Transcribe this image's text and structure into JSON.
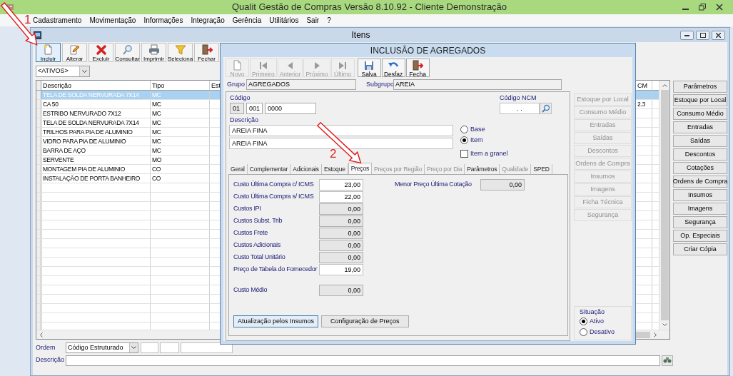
{
  "app": {
    "title": "Qualit Gestão de Compras Versão 8.10.92 - Cliente Demonstração"
  },
  "menu": [
    "Cadastramento",
    "Movimentação",
    "Informações",
    "Integração",
    "Gerência",
    "Utilitários",
    "Sair",
    "?"
  ],
  "itens_window": {
    "title": "Itens",
    "toolbar": [
      {
        "label": "Incluir",
        "kind": "new",
        "selected": true
      },
      {
        "label": "Alterar",
        "kind": "edit",
        "selected": false
      },
      {
        "label": "Excluir",
        "kind": "delete",
        "selected": false
      },
      {
        "label": "Consultar",
        "kind": "search",
        "selected": false
      },
      {
        "label": "Imprimir",
        "kind": "print",
        "selected": false
      },
      {
        "label": "Seleciona",
        "kind": "filter",
        "selected": false
      },
      {
        "label": "Fechar",
        "kind": "exit",
        "selected": false
      }
    ],
    "filter": "<ATIVOS>",
    "columns": [
      "Descrição",
      "Tipo",
      "Est"
    ],
    "ncm_header": "CM",
    "rows": [
      {
        "cells": [
          "TELA DE SOLDA NERVURADA 7X14",
          "MC"
        ],
        "selected": true
      },
      {
        "cells": [
          "CA 50",
          "MC"
        ],
        "ncm": "2.3",
        "selected": false
      },
      {
        "cells": [
          "ESTRIBO NERVURADO 7X12",
          "MC"
        ],
        "selected": false
      },
      {
        "cells": [
          "TELA DE SOLDA NERVURADA 7X14",
          "MC"
        ],
        "selected": false
      },
      {
        "cells": [
          "TRILHOS PARA PIA DE ALUMINIO",
          "MC"
        ],
        "selected": false
      },
      {
        "cells": [
          "VIDRO PARA PIA DE ALUMINIO",
          "MC"
        ],
        "selected": false
      },
      {
        "cells": [
          "BARRA DE AÇO",
          "MC"
        ],
        "selected": false
      },
      {
        "cells": [
          "SERVENTE",
          "MO"
        ],
        "selected": false
      },
      {
        "cells": [
          "MONTAGEM PIA DE ALUMINIO",
          "CO"
        ],
        "selected": false
      },
      {
        "cells": [
          "INSTALAÇÃO DE PORTA BANHEIRO",
          "CO"
        ],
        "selected": false
      }
    ],
    "side_buttons": [
      "Parâmetros",
      "Estoque por Local",
      "Consumo Médio",
      "Entradas",
      "Saídas",
      "Descontos",
      "Cotações",
      "Ordens de Compra",
      "Insumos",
      "Imagens",
      "Segurança",
      "Op. Especiais",
      "Criar Cópia"
    ],
    "order": {
      "label": "Ordem",
      "value": "Código Estruturado"
    },
    "search": {
      "label": "Descrição"
    }
  },
  "dialog": {
    "title": "INCLUSÃO DE AGREGADOS",
    "toolbar": [
      {
        "label": "Novo",
        "kind": "new",
        "disabled": true
      },
      {
        "label": "Primeiro",
        "kind": "first",
        "disabled": true
      },
      {
        "label": "Anterior",
        "kind": "prev",
        "disabled": true
      },
      {
        "label": "Próximo",
        "kind": "next",
        "disabled": true
      },
      {
        "label": "Último",
        "kind": "last",
        "disabled": true
      },
      {
        "label": "Salva",
        "kind": "save",
        "disabled": false
      },
      {
        "label": "Desfaz",
        "kind": "undo",
        "disabled": false
      },
      {
        "label": "Fecha",
        "kind": "exit",
        "disabled": false
      }
    ],
    "grupo": {
      "label": "Grupo",
      "value": "AGREGADOS"
    },
    "subgrupo": {
      "label": "Subgrupo",
      "value": "AREIA"
    },
    "codigo": {
      "label": "Código",
      "parts": [
        {
          "value": "01",
          "editable": false
        },
        {
          "value": "001",
          "editable": true
        },
        {
          "value": "0000",
          "editable": true
        }
      ]
    },
    "ncm": {
      "label": "Código NCM",
      "value": ". ."
    },
    "descricao": {
      "label": "Descrição",
      "lines": [
        "AREIA FINA",
        "AREIA FINA"
      ]
    },
    "type_options": [
      {
        "label": "Base",
        "selected": false
      },
      {
        "label": "Item",
        "selected": true
      }
    ],
    "granel": {
      "label": "Item a granel",
      "checked": false
    },
    "tabs": [
      {
        "label": "Geral",
        "selected": false,
        "disabled": false
      },
      {
        "label": "Complementar",
        "selected": false,
        "disabled": false
      },
      {
        "label": "Adicionais",
        "selected": false,
        "disabled": false
      },
      {
        "label": "Estoque",
        "selected": false,
        "disabled": false
      },
      {
        "label": "Preços",
        "selected": true,
        "disabled": false
      },
      {
        "label": "Preços por Região",
        "selected": false,
        "disabled": true
      },
      {
        "label": "Preço por Dia",
        "selected": false,
        "disabled": true
      },
      {
        "label": "Parâmetros",
        "selected": false,
        "disabled": false
      },
      {
        "label": "Qualidade",
        "selected": false,
        "disabled": true
      },
      {
        "label": "SPED",
        "selected": false,
        "disabled": false
      }
    ],
    "fields": [
      {
        "label": "Custo Última Compra c/ ICMS",
        "value": "23,00",
        "editable": true
      },
      {
        "label": "Custo Última Compra s/ ICMS",
        "value": "22,00",
        "editable": true
      },
      {
        "label": "Custos IPI",
        "value": "0,00",
        "editable": false
      },
      {
        "label": "Custos Subst. Trib",
        "value": "0,00",
        "editable": false
      },
      {
        "label": "Custos Frete",
        "value": "0,00",
        "editable": false
      },
      {
        "label": "Custos Adicionais",
        "value": "0,00",
        "editable": false
      },
      {
        "label": "Custo Total Unitário",
        "value": "0,00",
        "editable": false
      },
      {
        "label": "Preço de Tabela do Fornecedor",
        "value": "19,00",
        "editable": true
      }
    ],
    "menor_preco": {
      "label": "Menor Preço Última Cotação",
      "value": "0,00"
    },
    "custo_medio": {
      "label": "Custo Médio",
      "value": "0,00"
    },
    "buttons": [
      {
        "label": "Atualização pelos Insumos",
        "selected": true
      },
      {
        "label": "Configuração de Preços",
        "selected": false
      }
    ],
    "side_buttons": [
      {
        "label": "Estoque por Local",
        "disabled": true
      },
      {
        "label": "Consumo Médio",
        "disabled": true
      },
      {
        "label": "Entradas",
        "disabled": true
      },
      {
        "label": "Saídas",
        "disabled": true
      },
      {
        "label": "Descontos",
        "disabled": true
      },
      {
        "label": "Ordens de Compra",
        "disabled": true
      },
      {
        "label": "Insumos",
        "disabled": true
      },
      {
        "label": "Imagens",
        "disabled": true
      },
      {
        "label": "Ficha Técnica",
        "disabled": true
      },
      {
        "label": "Segurança",
        "disabled": true
      }
    ],
    "situacao": {
      "label": "Situação",
      "options": [
        {
          "label": "Ativo",
          "selected": true
        },
        {
          "label": "Desativo",
          "selected": false
        }
      ]
    }
  },
  "annotations": [
    {
      "label": "1"
    },
    {
      "label": "2"
    }
  ]
}
